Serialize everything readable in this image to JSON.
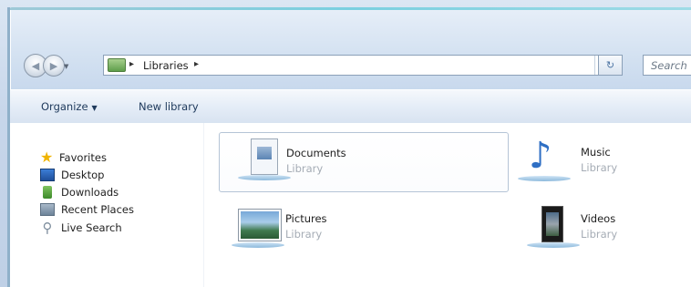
{
  "address_bar": {
    "path": [
      "Libraries"
    ],
    "dropdown_glyph": "▾",
    "refresh_glyph": "↻"
  },
  "search": {
    "placeholder": "Search"
  },
  "commands": [
    {
      "label": "Organize",
      "has_dropdown": true
    },
    {
      "label": "New library",
      "has_dropdown": false
    }
  ],
  "nav": {
    "favorites_label": "Favorites",
    "items": [
      {
        "label": "Desktop",
        "icon": "desktop-icon"
      },
      {
        "label": "Downloads",
        "icon": "downloads-icon"
      },
      {
        "label": "Recent Places",
        "icon": "recent-places-icon"
      },
      {
        "label": "Live Search",
        "icon": "search-icon"
      }
    ]
  },
  "libraries": [
    {
      "name": "Documents",
      "type": "Library",
      "icon": "documents-library-icon",
      "selected": true
    },
    {
      "name": "Music",
      "type": "Library",
      "icon": "music-library-icon",
      "selected": false
    },
    {
      "name": "Pictures",
      "type": "Library",
      "icon": "pictures-library-icon",
      "selected": false
    },
    {
      "name": "Videos",
      "type": "Library",
      "icon": "videos-library-icon",
      "selected": false
    }
  ],
  "colors": {
    "command_text": "#1e395b",
    "subtitle_text": "#a5acb5",
    "selection_border": "#b5c4d6"
  }
}
